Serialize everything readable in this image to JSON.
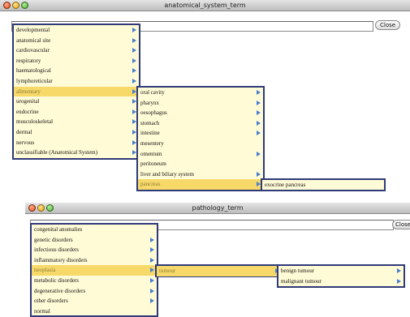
{
  "anatomical_window": {
    "title": "anatomical_system_term",
    "close_label": "Close",
    "level1": [
      {
        "label": "developmental",
        "arrow": true
      },
      {
        "label": "anatomical site",
        "arrow": true
      },
      {
        "label": "cardiovascular",
        "arrow": true
      },
      {
        "label": "respiratory",
        "arrow": true
      },
      {
        "label": "haematological",
        "arrow": true
      },
      {
        "label": "lymphoreticular",
        "arrow": true
      },
      {
        "label": "alimentary",
        "arrow": true,
        "selected": true
      },
      {
        "label": "urogenital",
        "arrow": true
      },
      {
        "label": "endocrine",
        "arrow": true
      },
      {
        "label": "musculoskeletal",
        "arrow": true
      },
      {
        "label": "dermal",
        "arrow": true
      },
      {
        "label": "nervous",
        "arrow": true
      },
      {
        "label": "unclassifiable (Anatomical System)",
        "arrow": true
      }
    ],
    "level2": [
      {
        "label": "oral cavity",
        "arrow": true
      },
      {
        "label": "pharynx",
        "arrow": true
      },
      {
        "label": "oesophagus",
        "arrow": true
      },
      {
        "label": "stomach",
        "arrow": true
      },
      {
        "label": "intestine",
        "arrow": true
      },
      {
        "label": "mesentery",
        "arrow": false
      },
      {
        "label": "omentum",
        "arrow": true
      },
      {
        "label": "peritoneum",
        "arrow": false
      },
      {
        "label": "liver and biliary system",
        "arrow": true
      },
      {
        "label": "pancreas",
        "arrow": true,
        "selected": true
      }
    ],
    "level3": [
      {
        "label": "exocrine pancreas",
        "arrow": false
      }
    ]
  },
  "pathology_window": {
    "title": "pathology_term",
    "close_label": "Close",
    "level1": [
      {
        "label": "congenital anomalies",
        "arrow": false
      },
      {
        "label": "genetic disorders",
        "arrow": true
      },
      {
        "label": "infectious disorders",
        "arrow": true
      },
      {
        "label": "inflammatory disorders",
        "arrow": true
      },
      {
        "label": "neoplasia",
        "arrow": true,
        "selected": true
      },
      {
        "label": "metabolic disorders",
        "arrow": true
      },
      {
        "label": "degenerative disorders",
        "arrow": true
      },
      {
        "label": "other disorders",
        "arrow": true
      },
      {
        "label": "normal",
        "arrow": false
      }
    ],
    "level2": [
      {
        "label": "tumour",
        "arrow": true,
        "selected": true
      }
    ],
    "level3": [
      {
        "label": "benign tumour",
        "arrow": true
      },
      {
        "label": "malignant tumour",
        "arrow": true
      }
    ]
  },
  "colors": {
    "menu_bg": "#fffbd6",
    "menu_border": "#2f3a78",
    "selection": "#f7d96a",
    "arrow": "#4a7fd0"
  }
}
